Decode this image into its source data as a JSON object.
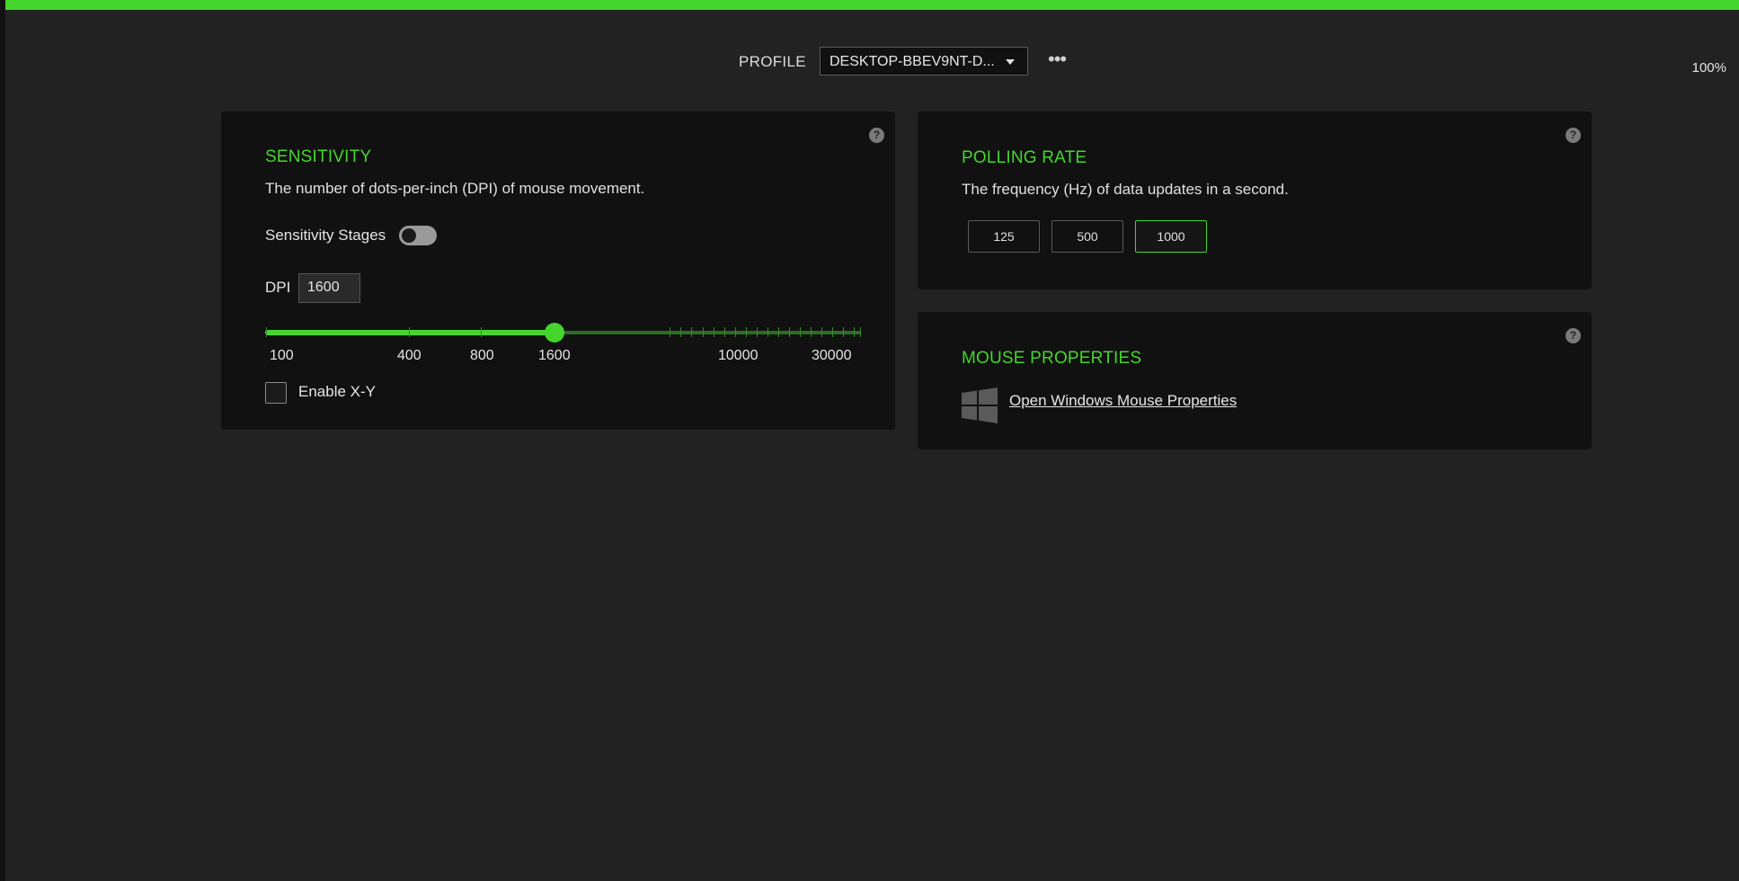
{
  "profile": {
    "label": "PROFILE",
    "selected": "DESKTOP-BBEV9NT-D...",
    "more_icon": "more-horizontal-icon"
  },
  "zoom": "100%",
  "sensitivity": {
    "title": "SENSITIVITY",
    "description": "The number of dots-per-inch (DPI) of mouse movement.",
    "stages_label": "Sensitivity Stages",
    "stages_enabled": false,
    "dpi_label": "DPI",
    "dpi_value": "1600",
    "slider_labels": [
      "100",
      "400",
      "800",
      "1600",
      "10000",
      "30000"
    ],
    "enable_xy_label": "Enable X-Y",
    "enable_xy_checked": false,
    "help": "?"
  },
  "polling": {
    "title": "POLLING RATE",
    "description": "The frequency (Hz) of data updates in a second.",
    "rates": [
      "125",
      "500",
      "1000"
    ],
    "selected": "1000",
    "help": "?"
  },
  "mouse_properties": {
    "title": "MOUSE PROPERTIES",
    "link": "Open Windows Mouse Properties",
    "icon": "windows-logo-icon",
    "help": "?"
  },
  "colors": {
    "accent": "#44d62c",
    "background": "#222222",
    "card": "#111111"
  }
}
